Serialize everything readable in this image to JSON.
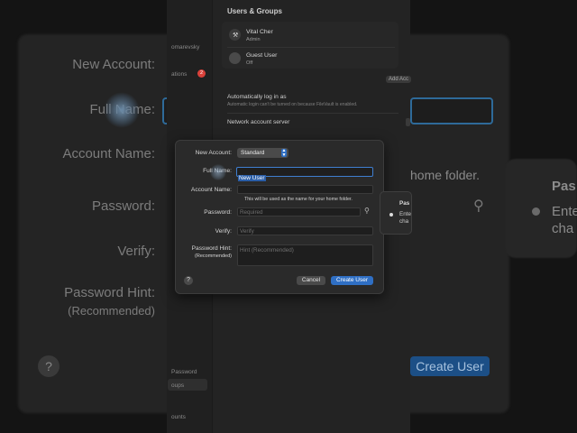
{
  "settings_pane": {
    "title": "Users & Groups",
    "users": [
      {
        "name": "Vital Cher",
        "role": "Admin"
      },
      {
        "name": "Guest User",
        "role": "Off"
      }
    ],
    "sidebar_partial": [
      "omarevsky",
      "ations",
      "Password",
      "oups",
      "ounts"
    ],
    "sidebar_badge": "2",
    "add_account_partial": "Add Acc",
    "auto_login_label": "Automatically log in as",
    "auto_login_note": "Automatic login can't be turned on because FileVault is enabled.",
    "network_server_label": "Network account server"
  },
  "dialog": {
    "new_account_label": "New Account:",
    "new_account_value": "Standard",
    "full_name_label": "Full Name:",
    "full_name_value": "New User",
    "account_name_label": "Account Name:",
    "account_name_hint": "This will be used as the name for your home folder.",
    "password_label": "Password:",
    "password_placeholder": "Required",
    "verify_label": "Verify:",
    "verify_placeholder": "Verify",
    "hint_label": "Password Hint:",
    "hint_sublabel": "(Recommended)",
    "hint_placeholder": "Hint (Recommended)",
    "help_glyph": "?",
    "cancel_label": "Cancel",
    "create_label": "Create User"
  },
  "popover": {
    "title_partial": "Pas",
    "line1_partial": "Ente",
    "line2_partial": "cha"
  },
  "background_zoom": {
    "new_account_label": "New Account:",
    "full_name_partial": "Full Name:",
    "account_name_label": "Account Name:",
    "password_label": "Password:",
    "verify_label": "Verify:",
    "hint_label": "Password Hint:",
    "hint_sublabel": "(Recommended)",
    "home_folder_partial": "home folder.",
    "create_partial": "Create User",
    "popover_title_partial": "Pas",
    "popover_line1_partial": "Ente",
    "popover_line2_partial": "cha",
    "help_glyph": "?"
  },
  "colors": {
    "accent": "#2f6fc4",
    "badge": "#d9413a"
  }
}
